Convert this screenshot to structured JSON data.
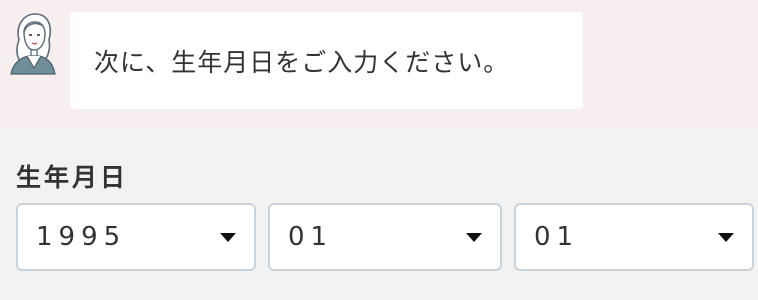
{
  "chat": {
    "avatar_icon": "woman-avatar-icon",
    "message": "次に、生年月日をご入力ください。"
  },
  "birthdate": {
    "label": "生年月日",
    "year": {
      "value": "1995"
    },
    "month": {
      "value": "01"
    },
    "day": {
      "value": "01"
    },
    "caret_icon": "caret-down-icon"
  }
}
